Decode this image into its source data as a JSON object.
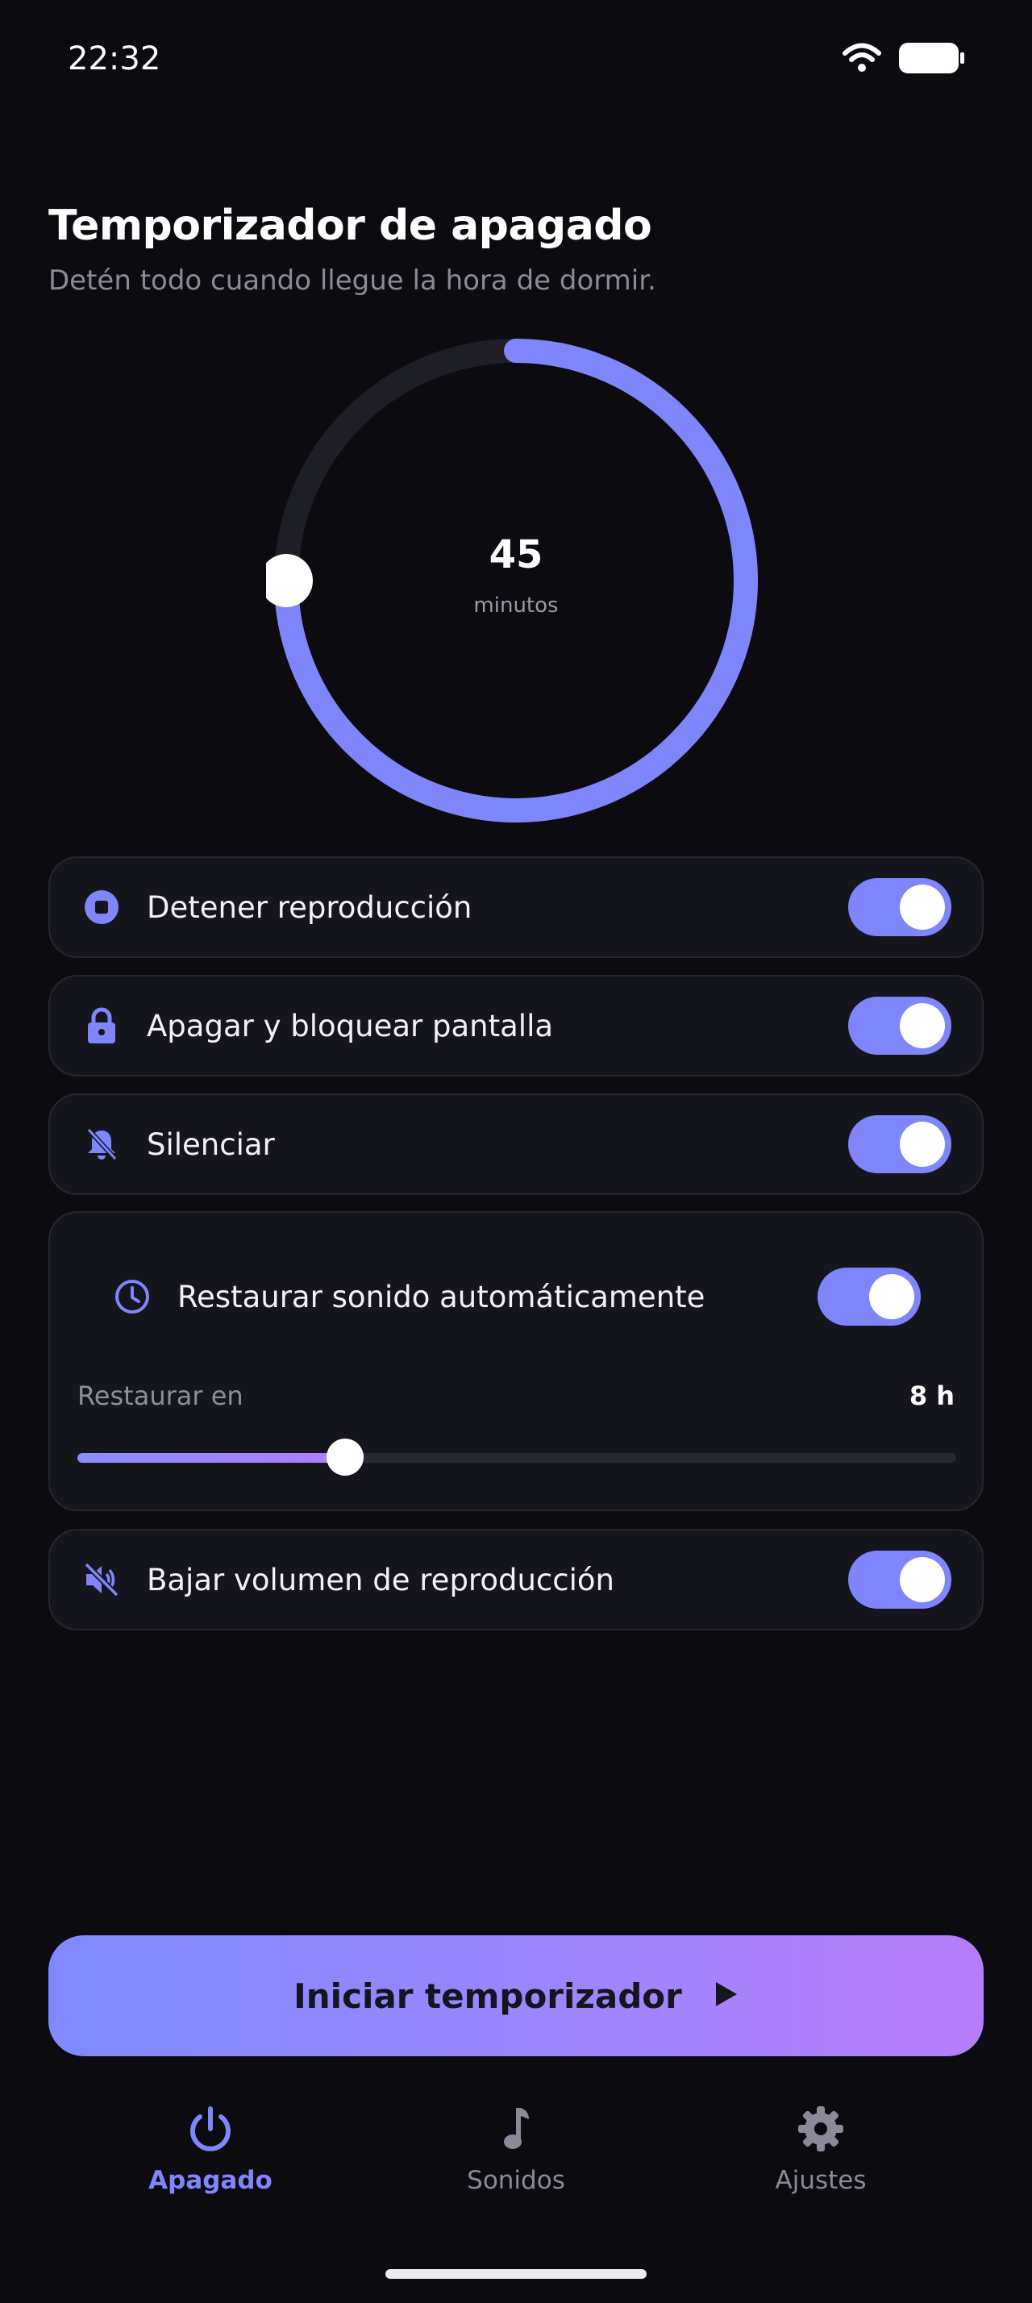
{
  "status_bar": {
    "time": "22:32"
  },
  "header": {
    "title": "Temporizador de apagado",
    "subtitle": "Detén todo cuando llegue la hora de dormir."
  },
  "timer": {
    "value": "45",
    "unit": "minutos",
    "progress_fraction": 0.75
  },
  "options": [
    {
      "label": "Detener reproducción",
      "icon": "stop-circle-icon",
      "enabled": true
    },
    {
      "label": "Apagar y bloquear pantalla",
      "icon": "lock-icon",
      "enabled": true
    },
    {
      "label": "Silenciar",
      "icon": "bell-off-icon",
      "enabled": true
    }
  ],
  "restore": {
    "label": "Restaurar sonido automáticamente",
    "icon": "clock-icon",
    "enabled": true,
    "restore_in_label": "Restaurar en",
    "restore_in_value": "8 h",
    "slider_fraction": 0.305
  },
  "lower_volume": {
    "label": "Bajar volumen de reproducción",
    "icon": "volume-mute-icon",
    "enabled": true
  },
  "start_button": {
    "label": "Iniciar temporizador",
    "icon": "play-icon"
  },
  "tabs": [
    {
      "label": "Apagado",
      "icon": "power-icon",
      "active": true
    },
    {
      "label": "Sonidos",
      "icon": "music-note-icon",
      "active": false
    },
    {
      "label": "Ajustes",
      "icon": "gear-icon",
      "active": false
    }
  ],
  "colors": {
    "accent": "#7f86fb",
    "accent_gradient_end": "#b67dfb",
    "background": "#0b0b10",
    "card": "#15151d",
    "muted_text": "#8a8a98"
  }
}
